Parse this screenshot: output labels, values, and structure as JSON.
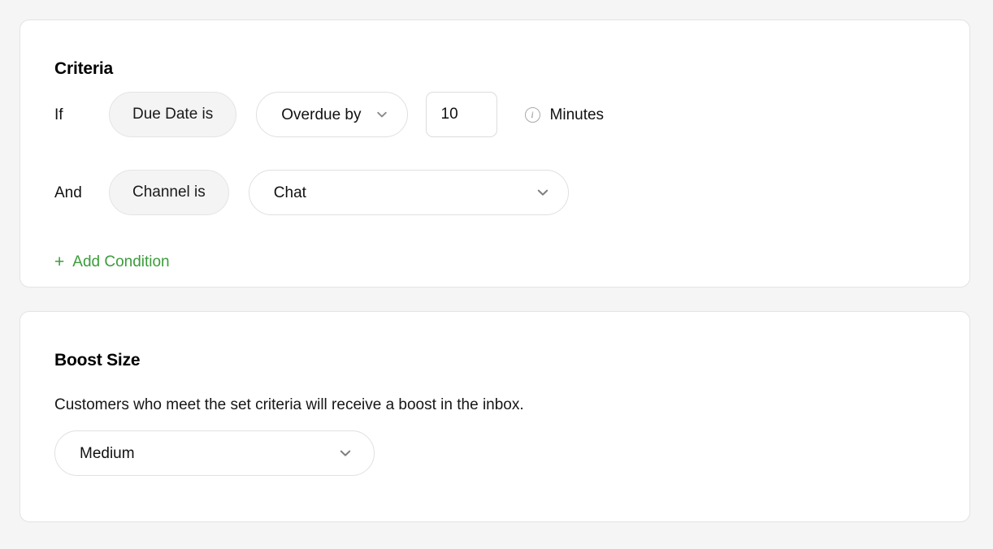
{
  "criteria": {
    "title": "Criteria",
    "conditions": [
      {
        "conjunction": "If",
        "field_label": "Due Date is",
        "operator": "Overdue by",
        "value": "10",
        "value_placeholder": "0",
        "info_icon": "info-circle-icon",
        "unit": "Minutes",
        "chevron_icon": "chevron-down-icon"
      },
      {
        "conjunction": "And",
        "field_label": "Channel is",
        "value_select": "Chat",
        "chevron_icon": "chevron-down-icon"
      }
    ],
    "add_condition": {
      "plus_icon": "+",
      "label": "Add Condition",
      "color": "#3b9c3b"
    }
  },
  "boost": {
    "title": "Boost Size",
    "description": "Customers who meet the set criteria will receive a boost in the inbox.",
    "size_value": "Medium",
    "chevron_icon": "chevron-down-icon"
  },
  "colors": {
    "page_background": "#f5f5f5",
    "card_background": "#ffffff",
    "card_border": "#e3e3e3",
    "pill_fill": "#f4f4f4",
    "accent_green": "#3b9c3b",
    "text_primary": "#111111",
    "icon_gray": "#8d8d8d"
  }
}
